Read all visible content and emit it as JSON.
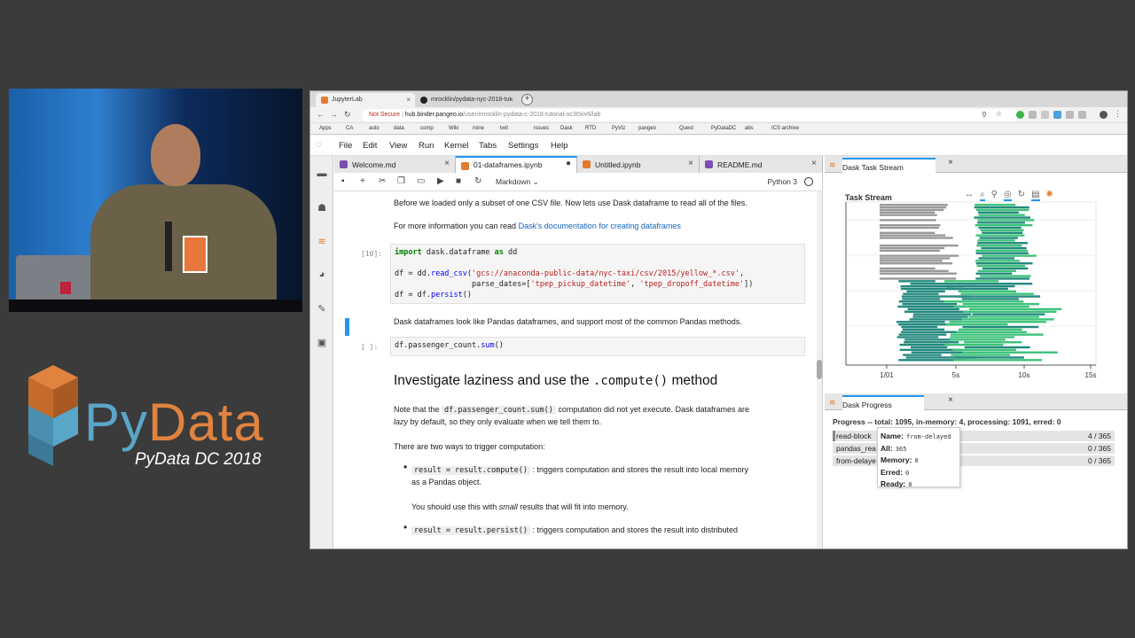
{
  "branding": {
    "word_py": "Py",
    "word_data": "Data",
    "subtitle": "PyData DC 2018"
  },
  "browser": {
    "tabs": [
      {
        "label": "JupyterLab",
        "active": true
      },
      {
        "label": "mrocklin/pydata-nyc-2018-tut",
        "active": false
      }
    ],
    "url": {
      "security": "Not Secure",
      "host": "hub.binder.pangeo.io",
      "path": "/user/mrocklin-pydata-c-2018-tutorial-oc30xiv6/lab"
    },
    "bookmarks": [
      "Apps",
      "CA",
      "auto",
      "data",
      "comp",
      "Wiki",
      "mine",
      "twit",
      "issues",
      "Dask",
      "RTD",
      "PyViz",
      "pangeo",
      "Quest",
      "PyDataDC",
      "abs",
      "ICS archive"
    ]
  },
  "jupyter": {
    "menu": [
      "File",
      "Edit",
      "View",
      "Run",
      "Kernel",
      "Tabs",
      "Settings",
      "Help"
    ],
    "doc_tabs": [
      {
        "label": "Welcome.md",
        "type": "md"
      },
      {
        "label": "01-dataframes.ipynb",
        "type": "nb",
        "active": true
      },
      {
        "label": "Untitled.ipynb",
        "type": "nb"
      },
      {
        "label": "README.md",
        "type": "md"
      }
    ],
    "toolbar": {
      "cell_type": "Markdown",
      "kernel": "Python 3"
    },
    "cells": {
      "p1": "Before we loaded only a subset of one CSV file. Now lets use Dask dataframe to read all of the files.",
      "p2_prefix": "For more information you can read ",
      "p2_link": "Dask's documentation for creating dataframes",
      "prompt1": "[10]:",
      "code1_l1_kw": "import",
      "code1_l1_mod": " dask.dataframe ",
      "code1_l1_as": "as",
      "code1_l1_alias": " dd",
      "code1_l3_a": "df = dd.",
      "code1_l3_fn": "read_csv",
      "code1_l3_b": "(",
      "code1_l3_str": "'gcs://anaconda-public-data/nyc-taxi/csv/2015/yellow_*.csv'",
      "code1_l3_c": ",",
      "code1_l4_a": "                 parse_dates=[",
      "code1_l4_s1": "'tpep_pickup_datetime'",
      "code1_l4_b": ", ",
      "code1_l4_s2": "'tpep_dropoff_datetime'",
      "code1_l4_c": "])",
      "code1_l5_a": "df = df.",
      "code1_l5_fn": "persist",
      "code1_l5_b": "()",
      "p3": "Dask dataframes look like Pandas dataframes, and support most of the common Pandas methods.",
      "prompt2": "[ ]:",
      "code2_a": "df.passenger_count.",
      "code2_fn": "sum",
      "code2_b": "()",
      "heading_a": "Investigate laziness and use the ",
      "heading_code": ".compute()",
      "heading_b": " method",
      "p4_a": "Note that the ",
      "p4_code": "df.passenger_count.sum()",
      "p4_b": " computation did not yet execute. Dask dataframes are",
      "p4_c_em": "lazy",
      "p4_c": " by default, so they only evaluate when we tell them to.",
      "p5": "There are two ways to trigger computation:",
      "b1_code": "result = result.compute()",
      "b1_text": " : triggers computation and stores the result into local memory",
      "b1_text2": "as a Pandas object.",
      "b1_note_a": "You should use this with ",
      "b1_note_em": "small",
      "b1_note_b": " results that will fit into memory.",
      "b2_code": "result = result.persist()",
      "b2_text": " : triggers computation and stores the result into distributed"
    }
  },
  "task_stream": {
    "tab_label": "Dask Task Stream",
    "title": "Task Stream",
    "x_ticks": [
      "1/01",
      "5s",
      "10s",
      "15s"
    ],
    "colors": {
      "dark": "#23897e",
      "light": "#3dc27a",
      "gray": "#9a9a9a"
    }
  },
  "progress": {
    "tab_label": "Dask Progress",
    "title": "Progress -- total: 1095, in-memory: 4, processing: 1091, erred: 0",
    "rows": [
      {
        "name": "read-block",
        "count": "4 / 365",
        "fraction": 0.011
      },
      {
        "name": "pandas_rea",
        "count": "0 / 365",
        "fraction": 0
      },
      {
        "name": "from-delaye",
        "count": "0 / 365",
        "fraction": 0
      }
    ],
    "tooltip": {
      "name_label": "Name:",
      "name_value": "from-delayed",
      "all_label": "All:",
      "all_value": "365",
      "memory_label": "Memory:",
      "memory_value": "0",
      "erred_label": "Erred:",
      "erred_value": "0",
      "ready_label": "Ready:",
      "ready_value": "0"
    }
  }
}
